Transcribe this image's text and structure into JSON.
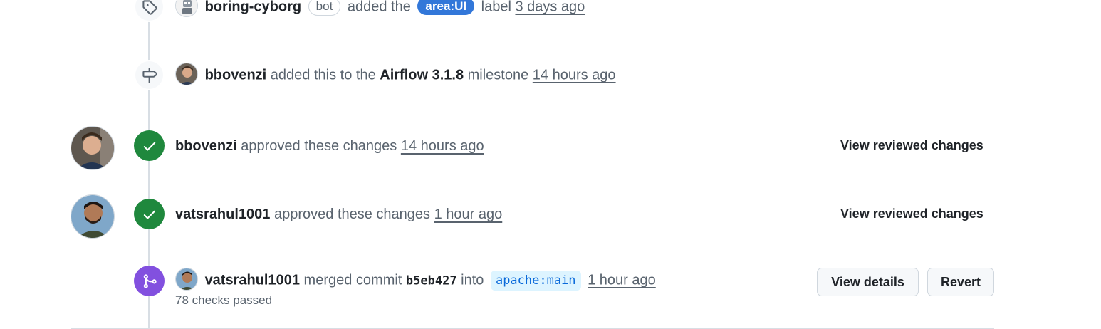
{
  "events": [
    {
      "type": "labeled",
      "icon": "tag-icon",
      "actor": "boring-cyborg",
      "bot_badge": "bot",
      "text_before": "added the",
      "label": "area:UI",
      "text_after": "label",
      "time": "3 days ago"
    },
    {
      "type": "milestoned",
      "icon": "milestone-icon",
      "actor": "bbovenzi",
      "text_before": "added this to the",
      "milestone": "Airflow 3.1.8",
      "text_after": "milestone",
      "time": "14 hours ago"
    },
    {
      "type": "approved",
      "icon": "check-icon",
      "actor": "bbovenzi",
      "text": "approved these changes",
      "time": "14 hours ago",
      "action": "View reviewed changes"
    },
    {
      "type": "approved",
      "icon": "check-icon",
      "actor": "vatsrahul1001",
      "text": "approved these changes",
      "time": "1 hour ago",
      "action": "View reviewed changes"
    },
    {
      "type": "merged",
      "icon": "git-merge-icon",
      "actor": "vatsrahul1001",
      "text_before": "merged commit",
      "commit": "b5eb427",
      "text_mid": "into",
      "branch": "apache:main",
      "time": "1 hour ago",
      "checks": "78 checks passed",
      "buttons": {
        "details": "View details",
        "revert": "Revert"
      }
    }
  ],
  "colors": {
    "approved_badge": "#1f883d",
    "merged_badge": "#8250df",
    "label_area_ui": "#3277d9",
    "branch_bg": "#ddf4ff",
    "branch_fg": "#0969da",
    "rail": "#d8dee4"
  }
}
